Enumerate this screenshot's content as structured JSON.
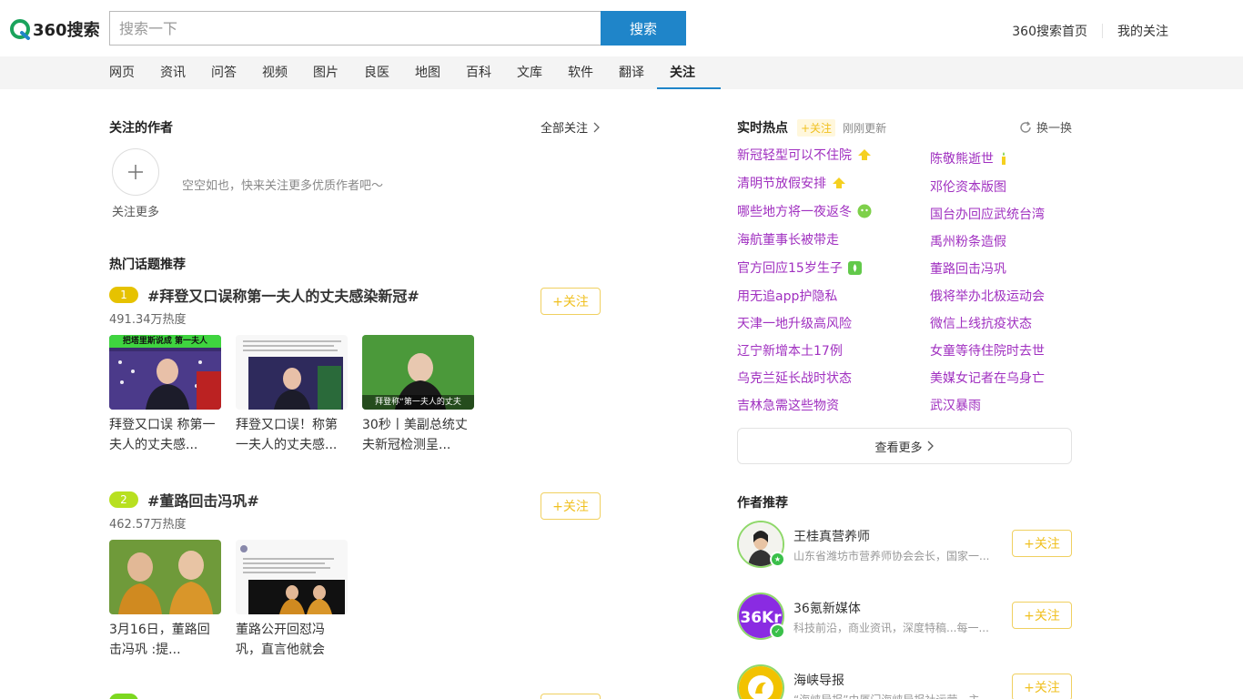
{
  "header": {
    "logo_text": "360搜索",
    "search_placeholder": "搜索一下",
    "search_button": "搜索",
    "links": [
      "360搜索首页",
      "我的关注"
    ]
  },
  "nav": {
    "items": [
      "网页",
      "资讯",
      "问答",
      "视频",
      "图片",
      "良医",
      "地图",
      "百科",
      "文库",
      "软件",
      "翻译",
      "关注"
    ],
    "active": "关注"
  },
  "follow_authors": {
    "title": "关注的作者",
    "all_follow": "全部关注",
    "add_label": "关注更多",
    "empty_tip": "空空如也，快来关注更多优质作者吧～"
  },
  "hot_topics": {
    "title": "热门话题推荐",
    "follow_label": "+关注",
    "items": [
      {
        "rank": "1",
        "rank_color": "#e6c200",
        "name": "#拜登又口误称第一夫人的丈夫感染新冠#",
        "heat": "491.34万热度",
        "thumbs": [
          {
            "caption": "拜登又口误 称第一夫人的丈夫感...",
            "banner": "把塔里斯说成 第一夫人"
          },
          {
            "caption": "拜登又口误！称第一夫人的丈夫感...",
            "banner": ""
          },
          {
            "caption": "30秒丨美副总统丈夫新冠检测呈...",
            "banner": "拜登称“第一夫人的丈夫"
          }
        ]
      },
      {
        "rank": "2",
        "rank_color": "#b8e020",
        "name": "#董路回击冯巩#",
        "heat": "462.57万热度",
        "thumbs": [
          {
            "caption": "3月16日，董路回击冯巩 :提...",
            "banner": ""
          },
          {
            "caption": "董路公开回怼冯巩，直言他就会",
            "banner": ""
          }
        ]
      }
    ]
  },
  "hot_now": {
    "title": "实时热点",
    "tag": "+关注",
    "updated": "刚刚更新",
    "refresh": "换一换",
    "left": [
      {
        "text": "新冠轻型可以不住院",
        "badge": "up"
      },
      {
        "text": "清明节放假安排",
        "badge": "up"
      },
      {
        "text": "哪些地方将一夜返冬",
        "badge": "new"
      },
      {
        "text": "海航董事长被带走",
        "badge": ""
      },
      {
        "text": "官方回应15岁生子",
        "badge": "hot"
      },
      {
        "text": "用无追app护隐私",
        "badge": ""
      },
      {
        "text": "天津一地升级高风险",
        "badge": ""
      },
      {
        "text": "辽宁新增本土17例",
        "badge": ""
      },
      {
        "text": "乌克兰延长战时状态",
        "badge": ""
      },
      {
        "text": "吉林急需这些物资",
        "badge": ""
      }
    ],
    "right": [
      {
        "text": "陈敬熊逝世",
        "badge": "candle"
      },
      {
        "text": "邓伦资本版图",
        "badge": ""
      },
      {
        "text": "国台办回应武统台湾",
        "badge": ""
      },
      {
        "text": "禹州粉条造假",
        "badge": ""
      },
      {
        "text": "董路回击冯巩",
        "badge": ""
      },
      {
        "text": "俄将举办北极运动会",
        "badge": ""
      },
      {
        "text": "微信上线抗疫状态",
        "badge": ""
      },
      {
        "text": "女童等待住院时去世",
        "badge": ""
      },
      {
        "text": "美媒女记者在乌身亡",
        "badge": ""
      },
      {
        "text": "武汉暴雨",
        "badge": ""
      }
    ],
    "view_more": "查看更多"
  },
  "author_rec": {
    "title": "作者推荐",
    "follow_label": "+关注",
    "items": [
      {
        "name": "王桂真营养师",
        "desc": "山东省潍坊市营养师协会会长，国家一..."
      },
      {
        "name": "36氪新媒体",
        "desc": "科技前沿，商业资讯，深度特稿...每一..."
      },
      {
        "name": "海峡导报",
        "desc": "“海峡导报”由厦门海峡导报社运营，主..."
      }
    ]
  }
}
